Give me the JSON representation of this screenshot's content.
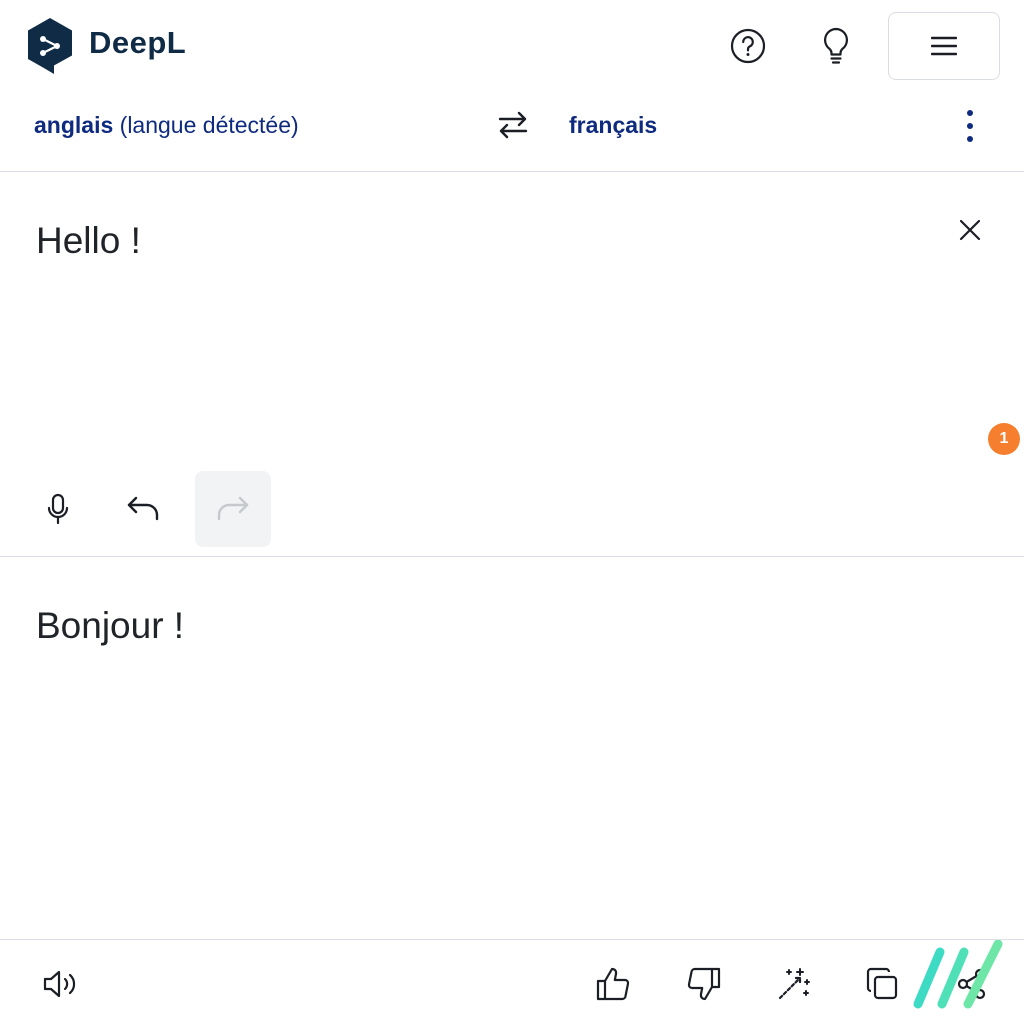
{
  "app": {
    "logo_text": "DeepL"
  },
  "header": {
    "icons": [
      "help-icon",
      "lightbulb-icon",
      "hamburger-menu-icon"
    ]
  },
  "languages": {
    "source_name": "anglais",
    "source_detected": "(langue détectée)",
    "target_name": "français"
  },
  "source": {
    "text": "Hello !",
    "notification_count": "1"
  },
  "target": {
    "text": "Bonjour !"
  },
  "colors": {
    "brand": "#0f2b46",
    "language_text": "#0f2b80",
    "badge": "#f57f2f",
    "watermark_teal": "#3ddbc4",
    "watermark_green": "#6de6a8"
  }
}
